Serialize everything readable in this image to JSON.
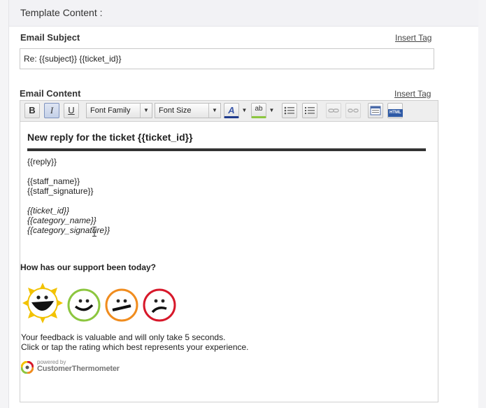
{
  "section": {
    "title": "Template Content :"
  },
  "subject": {
    "label": "Email Subject",
    "insert_tag": "Insert Tag",
    "value": "Re: {{subject}} {{ticket_id}}"
  },
  "content": {
    "label": "Email Content",
    "insert_tag": "Insert Tag"
  },
  "toolbar": {
    "bold": "B",
    "italic": "I",
    "underline": "U",
    "font_family": "Font Family",
    "font_size": "Font Size",
    "font_color": "A",
    "highlight": "ab",
    "html": "HTML",
    "dropdown_arrow": "▼"
  },
  "body": {
    "heading": "New reply for the ticket {{ticket_id}}",
    "reply": "{{reply}}",
    "staff_name": "{{staff_name}}",
    "staff_signature": "{{staff_signature}}",
    "ticket_id": "{{ticket_id}}",
    "category_name": "{{category_name}}",
    "category_signature": "{{category_signature}}",
    "survey_question": "How has our support been today?",
    "feedback_line1": "Your feedback is valuable and will only take 5 seconds.",
    "feedback_line2": "Click or tap the rating which best represents your experience.",
    "powered_by": "powered by",
    "brand": "CustomerThermometer"
  },
  "ratings": [
    {
      "icon": "gold-star-face-icon",
      "color": "#f2c200"
    },
    {
      "icon": "green-face-icon",
      "color": "#8cc63f"
    },
    {
      "icon": "amber-face-icon",
      "color": "#f08c1e"
    },
    {
      "icon": "red-face-icon",
      "color": "#d7182a"
    }
  ]
}
